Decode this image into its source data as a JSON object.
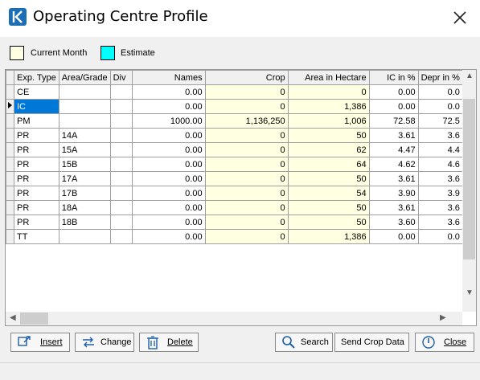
{
  "window": {
    "title": "Operating Centre Profile"
  },
  "legend": {
    "current_month": "Current Month",
    "estimate": "Estimate",
    "current_color": "#ffffe1",
    "estimate_color": "#00ffff"
  },
  "grid": {
    "headers": [
      "Exp. Type",
      "Area/Grade",
      "Div",
      "Names",
      "Crop",
      "Area in Hectare",
      "IC in %",
      "Depr in %"
    ],
    "rows": [
      [
        "CE",
        "",
        "",
        "0.00",
        "0",
        "0",
        "0.00",
        "0.0"
      ],
      [
        "IC",
        "",
        "",
        "0.00",
        "0",
        "1,386",
        "0.00",
        "0.0"
      ],
      [
        "PM",
        "",
        "",
        "1000.00",
        "1,136,250",
        "1,006",
        "72.58",
        "72.5"
      ],
      [
        "PR",
        "14A",
        "",
        "0.00",
        "0",
        "50",
        "3.61",
        "3.6"
      ],
      [
        "PR",
        "15A",
        "",
        "0.00",
        "0",
        "62",
        "4.47",
        "4.4"
      ],
      [
        "PR",
        "15B",
        "",
        "0.00",
        "0",
        "64",
        "4.62",
        "4.6"
      ],
      [
        "PR",
        "17A",
        "",
        "0.00",
        "0",
        "50",
        "3.61",
        "3.6"
      ],
      [
        "PR",
        "17B",
        "",
        "0.00",
        "0",
        "54",
        "3.90",
        "3.9"
      ],
      [
        "PR",
        "18A",
        "",
        "0.00",
        "0",
        "50",
        "3.61",
        "3.6"
      ],
      [
        "PR",
        "18B",
        "",
        "0.00",
        "0",
        "50",
        "3.60",
        "3.6"
      ],
      [
        "TT",
        "",
        "",
        "0.00",
        "0",
        "1,386",
        "0.00",
        "0.0"
      ]
    ]
  },
  "buttons": {
    "insert": "Insert",
    "change": "Change",
    "delete": "Delete",
    "search": "Search",
    "send_crop": "Send Crop Data",
    "close": "Close"
  }
}
